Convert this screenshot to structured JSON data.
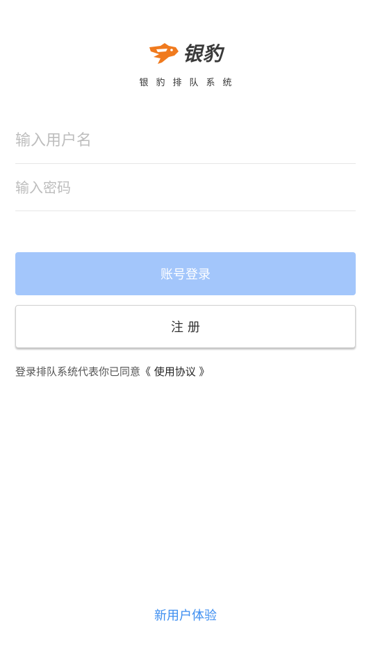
{
  "brand": {
    "name": "银豹",
    "subtitle": "银豹排队系统",
    "accent_color": "#f07a1e",
    "logo_icon": "leopard-head-icon"
  },
  "login_form": {
    "username_placeholder": "输入用户名",
    "password_placeholder": "输入密码",
    "login_button_label": "账号登录",
    "register_button_label": "注册"
  },
  "agreement": {
    "prefix_text": "登录排队系统代表你已同意",
    "link_text": "《 使用协议 》"
  },
  "footer": {
    "new_user_link": "新用户体验",
    "link_color": "#3d8ef0"
  },
  "colors": {
    "primary_button_bg": "#a3c6fb"
  }
}
